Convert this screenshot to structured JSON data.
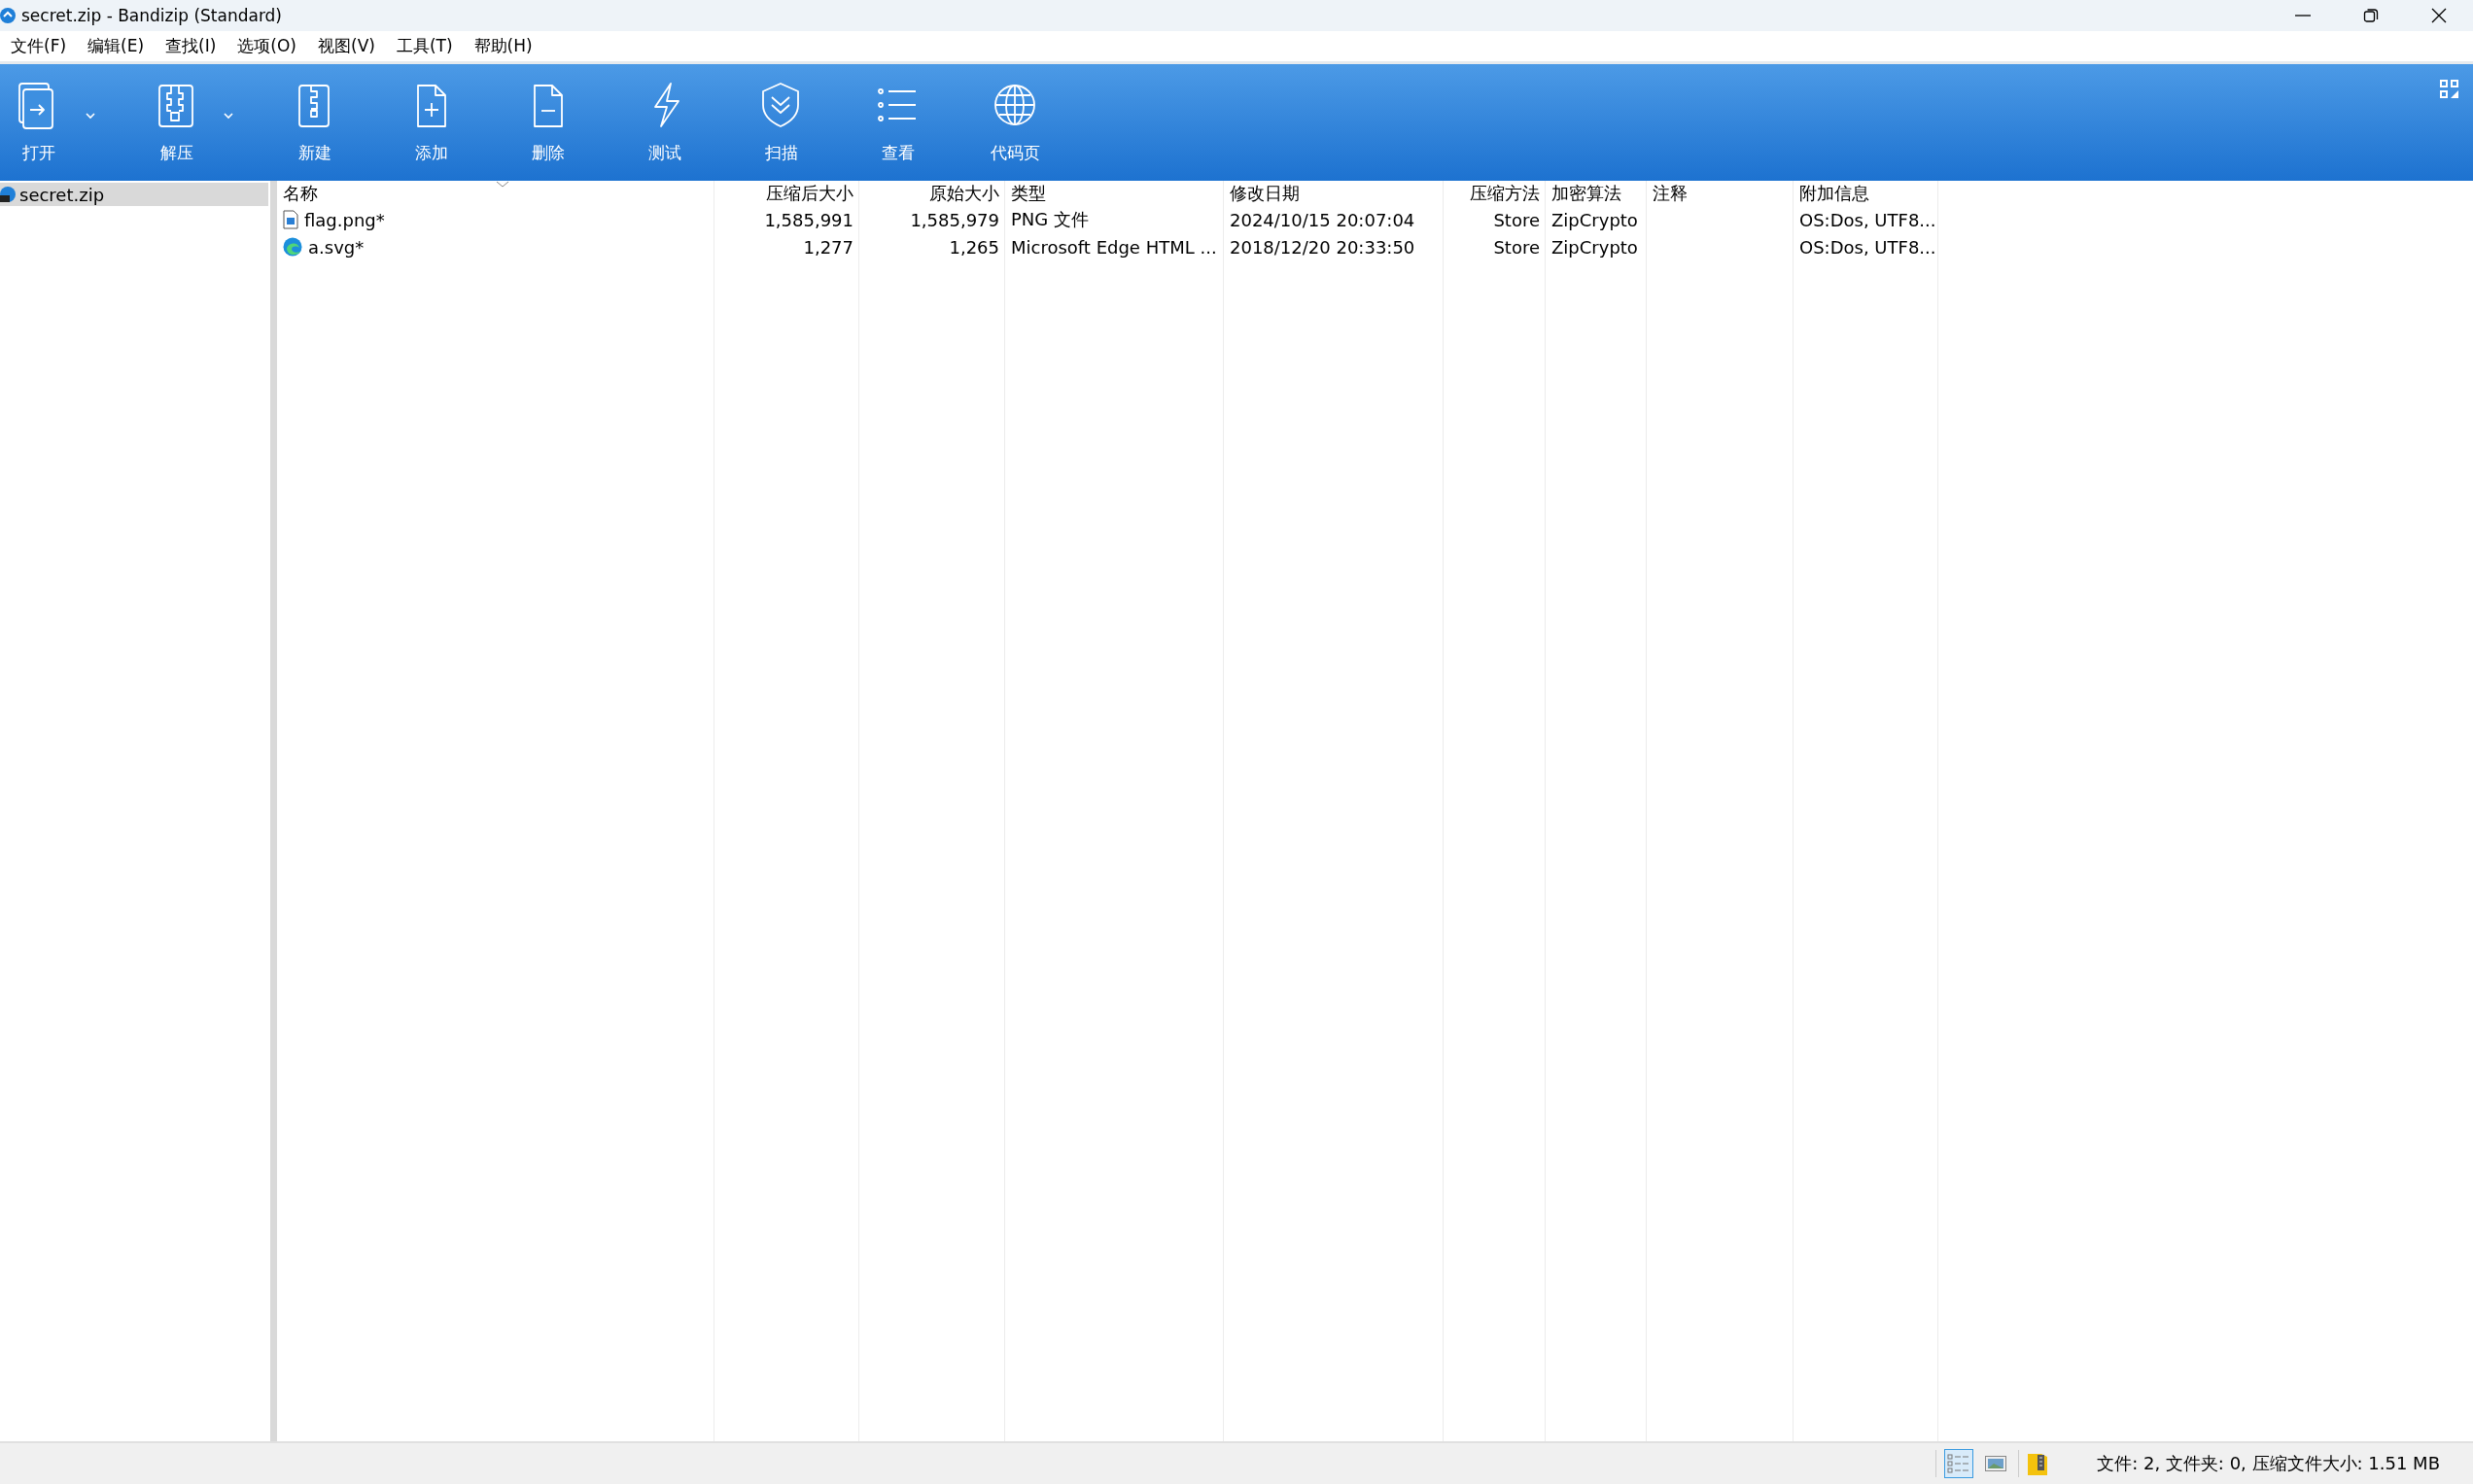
{
  "window": {
    "title": "secret.zip - Bandizip (Standard)"
  },
  "menu": [
    "文件(F)",
    "编辑(E)",
    "查找(I)",
    "选项(O)",
    "视图(V)",
    "工具(T)",
    "帮助(H)"
  ],
  "toolbar": [
    {
      "kind": "open",
      "label": "打开",
      "dropdown": true
    },
    {
      "kind": "extract",
      "label": "解压",
      "dropdown": true
    },
    {
      "kind": "new",
      "label": "新建",
      "dropdown": false
    },
    {
      "kind": "add",
      "label": "添加",
      "dropdown": false
    },
    {
      "kind": "delete",
      "label": "删除",
      "dropdown": false
    },
    {
      "kind": "test",
      "label": "测试",
      "dropdown": false
    },
    {
      "kind": "scan",
      "label": "扫描",
      "dropdown": false
    },
    {
      "kind": "view",
      "label": "查看",
      "dropdown": false
    },
    {
      "kind": "codepage",
      "label": "代码页",
      "dropdown": false
    }
  ],
  "sidebar": {
    "items": [
      {
        "label": "secret.zip",
        "selected": true
      }
    ]
  },
  "table": {
    "columns": [
      "名称",
      "压缩后大小",
      "原始大小",
      "类型",
      "修改日期",
      "压缩方法",
      "加密算法",
      "注释",
      "附加信息"
    ],
    "rows": [
      {
        "kind": "image",
        "cells": [
          "flag.png*",
          "1,585,991",
          "1,585,979",
          "PNG 文件",
          "2024/10/15 20:07:04",
          "Store",
          "ZipCrypto",
          "",
          "OS:Dos, UTF8..."
        ]
      },
      {
        "kind": "web",
        "cells": [
          "a.svg*",
          "1,277",
          "1,265",
          "Microsoft Edge HTML ...",
          "2018/12/20 20:33:50",
          "Store",
          "ZipCrypto",
          "",
          "OS:Dos, UTF8..."
        ]
      }
    ]
  },
  "status_bar": {
    "views": [
      {
        "kind": "details",
        "selected": true
      },
      {
        "kind": "thumbnails",
        "selected": false
      }
    ],
    "text": "文件: 2, 文件夹: 0, 压缩文件大小: 1.51 MB"
  }
}
